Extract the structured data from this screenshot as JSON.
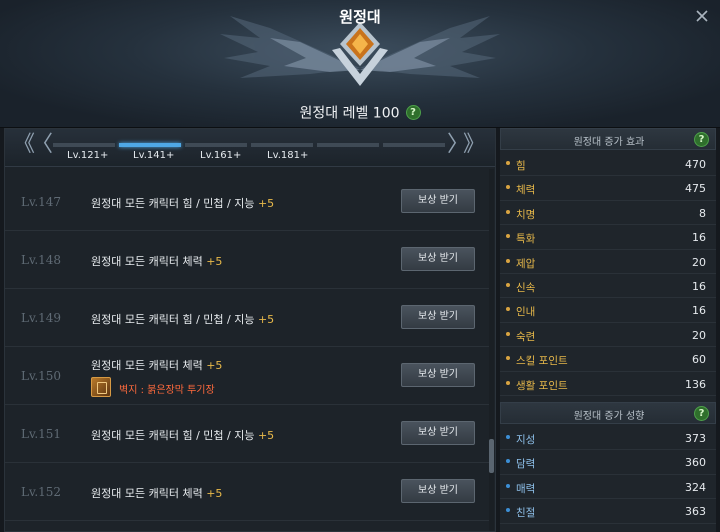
{
  "header": {
    "title": "원정대",
    "level_text": "원정대 레벨 100",
    "help": "?",
    "close": "✕"
  },
  "tabs": {
    "labels": [
      "Lv.121+",
      "Lv.141+",
      "Lv.161+",
      "Lv.181+"
    ],
    "active_index": 1,
    "first_arrow": "《",
    "prev_arrow": "〈",
    "next_arrow": "〉",
    "last_arrow": "》"
  },
  "rows": [
    {
      "level": "Lv.147",
      "desc": "원정대 모든 캐릭터 힘 / 민첩 / 지능",
      "bonus": "+5",
      "button": "보상 받기"
    },
    {
      "level": "Lv.148",
      "desc": "원정대 모든 캐릭터 체력",
      "bonus": "+5",
      "button": "보상 받기"
    },
    {
      "level": "Lv.149",
      "desc": "원정대 모든 캐릭터 힘 / 민첩 / 지능",
      "bonus": "+5",
      "button": "보상 받기"
    },
    {
      "level": "Lv.150",
      "desc": "원정대 모든 캐릭터 체력",
      "bonus": "+5",
      "button": "보상 받기",
      "reward": "벽지 : 붉은장막 투기장"
    },
    {
      "level": "Lv.151",
      "desc": "원정대 모든 캐릭터 힘 / 민첩 / 지능",
      "bonus": "+5",
      "button": "보상 받기"
    },
    {
      "level": "Lv.152",
      "desc": "원정대 모든 캐릭터 체력",
      "bonus": "+5",
      "button": "보상 받기"
    }
  ],
  "stat_effects": {
    "title": "원정대 증가 효과",
    "items": [
      {
        "name": "힘",
        "value": "470"
      },
      {
        "name": "체력",
        "value": "475"
      },
      {
        "name": "치명",
        "value": "8"
      },
      {
        "name": "특화",
        "value": "16"
      },
      {
        "name": "제압",
        "value": "20"
      },
      {
        "name": "신속",
        "value": "16"
      },
      {
        "name": "인내",
        "value": "16"
      },
      {
        "name": "숙련",
        "value": "20"
      },
      {
        "name": "스킬 포인트",
        "value": "60"
      },
      {
        "name": "생활 포인트",
        "value": "136"
      }
    ]
  },
  "tendencies": {
    "title": "원정대 증가 성향",
    "items": [
      {
        "name": "지성",
        "value": "373"
      },
      {
        "name": "담력",
        "value": "360"
      },
      {
        "name": "매력",
        "value": "324"
      },
      {
        "name": "친절",
        "value": "363"
      }
    ]
  },
  "colors": {
    "accent_blue": "#4fa8e6",
    "stat_gold": "#e8b94a",
    "tendency_blue": "#8ec0ea",
    "reward_orange": "#ff6a3d",
    "help_green": "#2f6f2c"
  }
}
